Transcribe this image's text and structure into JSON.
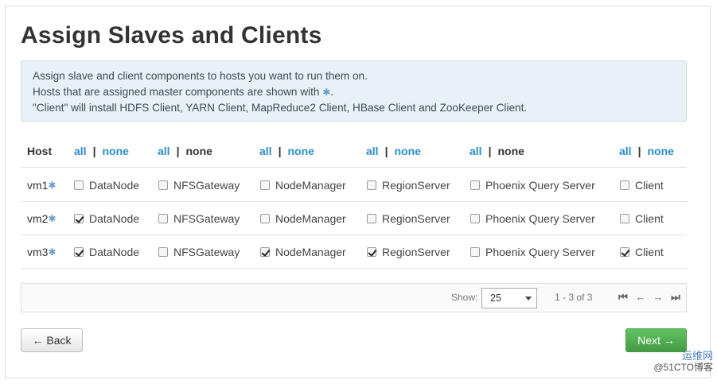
{
  "page": {
    "title": "Assign Slaves and Clients"
  },
  "info": {
    "line1": "Assign slave and client components to hosts you want to run them on.",
    "line2_prefix": "Hosts that are assigned master components are shown with",
    "line2_suffix": ".",
    "line3": "\"Client\" will install HDFS Client, YARN Client, MapReduce2 Client, HBase Client and ZooKeeper Client.",
    "master_marker": "✱"
  },
  "table": {
    "host_header": "Host",
    "all_label": "all",
    "none_label": "none",
    "separator": "|",
    "components": [
      "DataNode",
      "NFSGateway",
      "NodeManager",
      "RegionServer",
      "Phoenix Query Server",
      "Client"
    ],
    "rows": [
      {
        "host": "vm1",
        "checked": [
          false,
          false,
          false,
          false,
          false,
          false
        ]
      },
      {
        "host": "vm2",
        "checked": [
          true,
          false,
          false,
          false,
          false,
          false
        ]
      },
      {
        "host": "vm3",
        "checked": [
          true,
          false,
          true,
          true,
          false,
          true
        ]
      }
    ]
  },
  "pager": {
    "show_label": "Show:",
    "page_size": "25",
    "range": "1 - 3 of 3"
  },
  "buttons": {
    "back": "← Back",
    "next": "Next →"
  },
  "watermark": {
    "line1": "运维网",
    "line2": "@51CTO博客"
  },
  "colors": {
    "link": "#2a8ec6",
    "info_bg": "#e8f1f6",
    "next_bg": "#5cb85c"
  }
}
